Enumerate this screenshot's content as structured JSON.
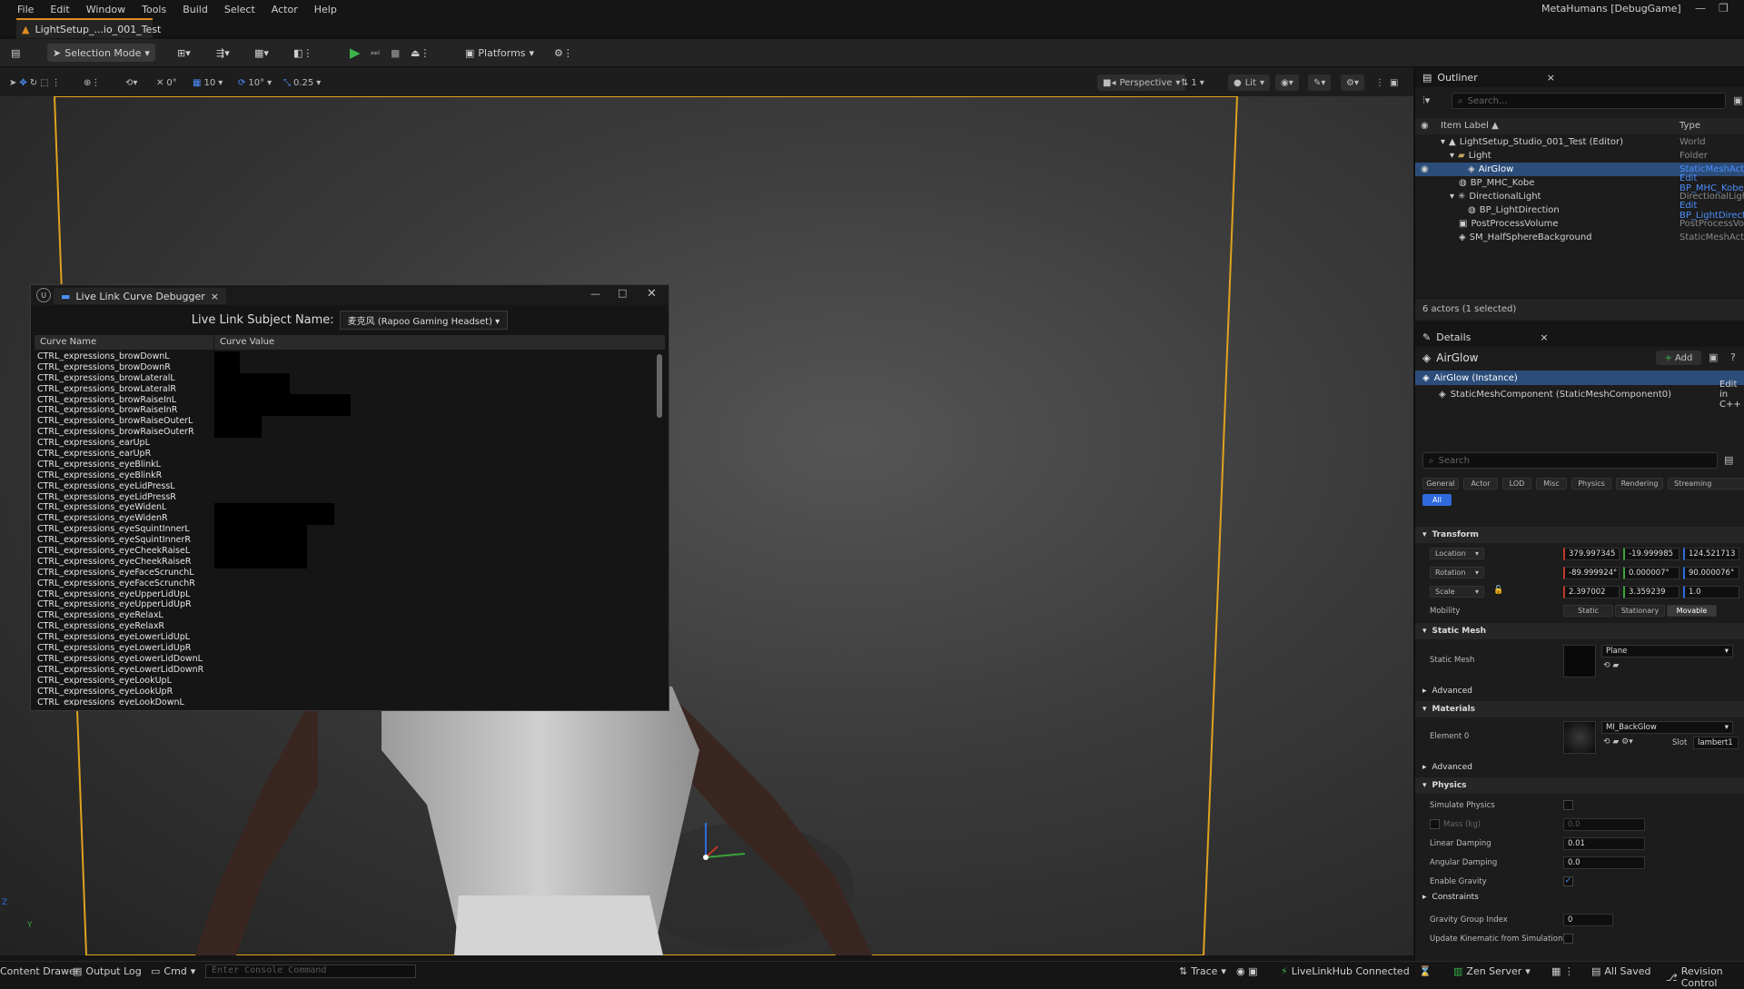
{
  "menu": {
    "items": [
      "File",
      "Edit",
      "Window",
      "Tools",
      "Build",
      "Select",
      "Actor",
      "Help"
    ],
    "project": "MetaHumans [DebugGame]"
  },
  "level_tab": {
    "label": "LightSetup_...io_001_Test"
  },
  "toolbar": {
    "selection_mode": "Selection Mode",
    "platforms": "Platforms"
  },
  "viewport_bar": {
    "translate_snap": "0°",
    "grid_snap": "10",
    "rotate_snap": "10°",
    "scale_snap": "0.25",
    "perspective": "Perspective",
    "camera_speed": "1",
    "lit": "Lit"
  },
  "status_bar": {
    "content_drawer": "Content Drawer",
    "output_log": "Output Log",
    "cmd": "Cmd",
    "console_placeholder": "Enter Console Command",
    "trace": "Trace",
    "livelink": "LiveLinkHub Connected",
    "zen": "Zen Server",
    "saved": "All Saved",
    "revision": "Revision Control"
  },
  "debugger": {
    "title": "Live Link Curve Debugger",
    "subject_label": "Live Link Subject Name:",
    "subject_value": "麦克风 (Rapoo Gaming Headset)",
    "col_name": "Curve Name",
    "col_value": "Curve Value",
    "curves": [
      "CTRL_expressions_browDownL",
      "CTRL_expressions_browDownR",
      "CTRL_expressions_browLateralL",
      "CTRL_expressions_browLateralR",
      "CTRL_expressions_browRaiseInL",
      "CTRL_expressions_browRaiseInR",
      "CTRL_expressions_browRaiseOuterL",
      "CTRL_expressions_browRaiseOuterR",
      "CTRL_expressions_earUpL",
      "CTRL_expressions_earUpR",
      "CTRL_expressions_eyeBlinkL",
      "CTRL_expressions_eyeBlinkR",
      "CTRL_expressions_eyeLidPressL",
      "CTRL_expressions_eyeLidPressR",
      "CTRL_expressions_eyeWidenL",
      "CTRL_expressions_eyeWidenR",
      "CTRL_expressions_eyeSquintInnerL",
      "CTRL_expressions_eyeSquintInnerR",
      "CTRL_expressions_eyeCheekRaiseL",
      "CTRL_expressions_eyeCheekRaiseR",
      "CTRL_expressions_eyeFaceScrunchL",
      "CTRL_expressions_eyeFaceScrunchR",
      "CTRL_expressions_eyeUpperLidUpL",
      "CTRL_expressions_eyeUpperLidUpR",
      "CTRL_expressions_eyeRelaxL",
      "CTRL_expressions_eyeRelaxR",
      "CTRL_expressions_eyeLowerLidUpL",
      "CTRL_expressions_eyeLowerLidUpR",
      "CTRL_expressions_eyeLowerLidDownL",
      "CTRL_expressions_eyeLowerLidDownR",
      "CTRL_expressions_eyeLookUpL",
      "CTRL_expressions_eyeLookUpR",
      "CTRL_expressions_eyeLookDownL"
    ]
  },
  "outliner": {
    "title": "Outliner",
    "search_placeholder": "Search...",
    "col_label": "Item Label ▲",
    "col_type": "Type",
    "rows": [
      {
        "name": "LightSetup_Studio_001_Test (Editor)",
        "type": "World"
      },
      {
        "name": "Light",
        "type": "Folder"
      },
      {
        "name": "AirGlow",
        "type": "StaticMeshActor"
      },
      {
        "name": "BP_MHC_Kobe",
        "type": "Edit BP_MHC_Kobe"
      },
      {
        "name": "DirectionalLight",
        "type": "DirectionalLight"
      },
      {
        "name": "BP_LightDirection",
        "type": "Edit BP_LightDirection"
      },
      {
        "name": "PostProcessVolume",
        "type": "PostProcessVolume"
      },
      {
        "name": "SM_HalfSphereBackground",
        "type": "StaticMeshActor"
      }
    ],
    "footer": "6 actors (1 selected)"
  },
  "details": {
    "title": "Details",
    "actor": "AirGlow",
    "add": "Add",
    "instance": "AirGlow (Instance)",
    "component": "StaticMeshComponent (StaticMeshComponent0)",
    "component_edit": "Edit in C++",
    "search_placeholder": "Search",
    "filters": [
      "General",
      "Actor",
      "LOD",
      "Misc",
      "Physics",
      "Rendering",
      "Streaming"
    ],
    "filter_all": "All",
    "transform": {
      "title": "Transform",
      "location": "Location",
      "rotation": "Rotation",
      "scale": "Scale",
      "mobility": "Mobility",
      "loc": [
        "379.997345",
        "-19.999985",
        "124.521713"
      ],
      "rot": [
        "-89.999924°",
        "0.000007°",
        "90.000076°"
      ],
      "scl": [
        "2.397002",
        "3.359239",
        "1.0"
      ],
      "mob": [
        "Static",
        "Stationary",
        "Movable"
      ]
    },
    "static_mesh": {
      "title": "Static Mesh",
      "label": "Static Mesh",
      "value": "Plane"
    },
    "advanced": "Advanced",
    "materials": {
      "title": "Materials",
      "element": "Element 0",
      "value": "MI_BackGlow",
      "slot_label": "Slot",
      "slot_value": "lambert1"
    },
    "physics": {
      "title": "Physics",
      "simulate": "Simulate Physics",
      "mass": "Mass (kg)",
      "mass_value": "0.0",
      "linear": "Linear Damping",
      "linear_value": "0.01",
      "angular": "Angular Damping",
      "angular_value": "0.0",
      "gravity": "Enable Gravity"
    },
    "constraints": "Constraints",
    "gravity_group": "Gravity Group Index",
    "gravity_group_value": "0",
    "kinematic": "Update Kinematic from Simulation"
  },
  "colors": {
    "accent": "#e08b1e",
    "selection": "#2c4d7a",
    "play": "#3bb54a",
    "link": "#4d90ff"
  }
}
